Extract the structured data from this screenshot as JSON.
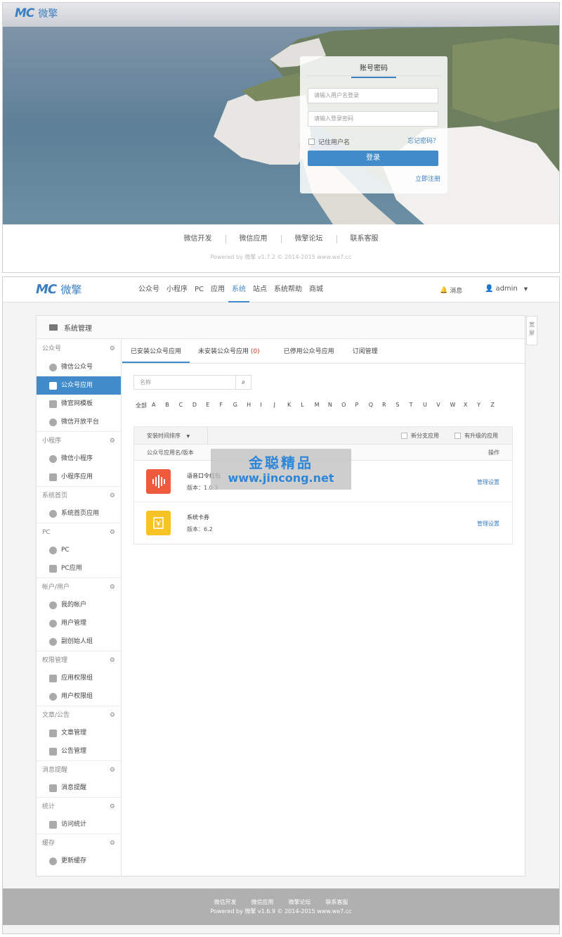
{
  "login": {
    "logo_mark": "MC",
    "logo_text": "微擎",
    "tab": "账号密码",
    "username_placeholder": "请输入用户名登录",
    "password_placeholder": "请输入登录密码",
    "remember": "记住用户名",
    "forgot": "忘记密码？",
    "submit": "登录",
    "register": "立即注册",
    "footer_links": [
      "微信开发",
      "微信应用",
      "微擎论坛",
      "联系客服"
    ],
    "copyright": "Powered by 微擎 v1.7.2 © 2014-2015 www.we7.cc"
  },
  "admin": {
    "logo_mark": "MC",
    "logo_text": "微擎",
    "nav": [
      "公众号",
      "小程序",
      "PC",
      "应用",
      "系统",
      "站点",
      "系统帮助",
      "商城"
    ],
    "messages": "消息",
    "user": "admin",
    "panel_title": "系统管理",
    "wide_tab": "宽屏",
    "sidebar": [
      {
        "group": "公众号",
        "items": [
          "微信公众号",
          "公众号应用",
          "微官网模板",
          "微信开放平台"
        ]
      },
      {
        "group": "小程序",
        "items": [
          "微信小程序",
          "小程序应用"
        ]
      },
      {
        "group": "系统首页",
        "items": [
          "系统首页应用"
        ]
      },
      {
        "group": "PC",
        "items": [
          "PC",
          "PC应用"
        ]
      },
      {
        "group": "帐户/用户",
        "items": [
          "我的帐户",
          "用户管理",
          "副创始人组"
        ]
      },
      {
        "group": "权限管理",
        "items": [
          "应用权限组",
          "用户权限组"
        ]
      },
      {
        "group": "文章/公告",
        "items": [
          "文章管理",
          "公告管理"
        ]
      },
      {
        "group": "消息提醒",
        "items": [
          "消息提醒"
        ]
      },
      {
        "group": "统计",
        "items": [
          "访问统计"
        ]
      },
      {
        "group": "缓存",
        "items": [
          "更新缓存"
        ]
      }
    ],
    "tabs": [
      {
        "label": "已安装公众号应用",
        "count": ""
      },
      {
        "label": "未安装公众号应用 ",
        "count": "(0)"
      },
      {
        "label": "已停用公众号应用",
        "count": ""
      },
      {
        "label": "订阅管理",
        "count": ""
      }
    ],
    "search_placeholder": "名称",
    "alphabet": [
      "全部",
      "A",
      "B",
      "C",
      "D",
      "E",
      "F",
      "G",
      "H",
      "I",
      "J",
      "K",
      "L",
      "M",
      "N",
      "O",
      "P",
      "Q",
      "R",
      "S",
      "T",
      "U",
      "V",
      "W",
      "X",
      "Y",
      "Z"
    ],
    "sort": "安装时间排序",
    "filter_new": "新分支应用",
    "filter_upgrade": "有升级的应用",
    "col_name": "公众号应用名/版本",
    "col_action": "操作",
    "apps": [
      {
        "name": "语音口令红包",
        "version": "版本：1.0.3",
        "action": "管理设置",
        "color": "#ee5a3c"
      },
      {
        "name": "系统卡券",
        "version": "版本：6.2",
        "action": "管理设置",
        "color": "#f6c224"
      }
    ],
    "watermark_line1": "金聪精品",
    "watermark_line2": "www.jincong.net",
    "footer_links": [
      "微信开发",
      "微信应用",
      "微擎论坛",
      "联系客服"
    ],
    "copyright": "Powered by 微擎 v1.6.9 © 2014-2015 www.we7.cc"
  },
  "colors": {
    "accent": "#428bca",
    "link": "#3b7fc1",
    "footer_bg": "#b0b0b0"
  }
}
